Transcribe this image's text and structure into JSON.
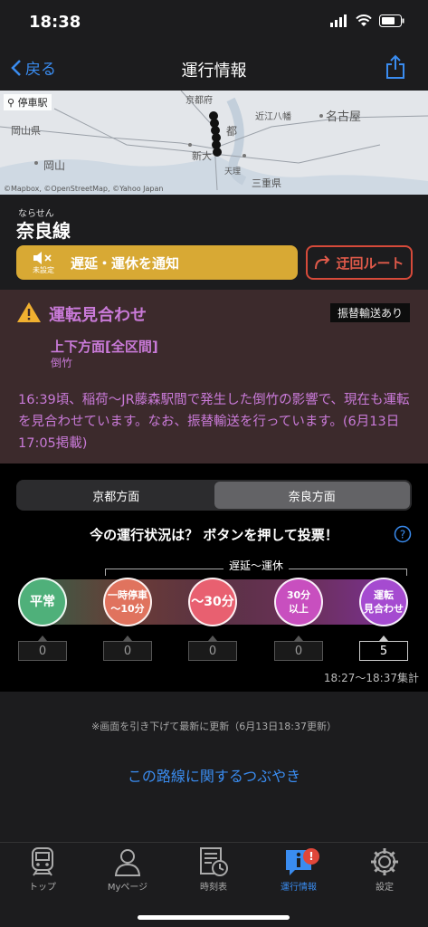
{
  "status_bar": {
    "time": "18:38"
  },
  "nav": {
    "back_label": "戻る",
    "title": "運行情報"
  },
  "map": {
    "station_label": "停車駅",
    "credit": "©Mapbox, ©OpenStreetMap, ©Yahoo Japan",
    "places": [
      "京都府",
      "都",
      "近江八幡",
      "名古屋",
      "岡山県",
      "新大",
      "天理",
      "三重県",
      "岡山"
    ]
  },
  "line": {
    "ruby": "ならせん",
    "name": "奈良線",
    "notify_sub": "未設定",
    "notify_label": "遅延・運休を通知",
    "detour_label": "迂回ルート"
  },
  "alert": {
    "title": "運転見合わせ",
    "badge": "振替輸送あり",
    "section": "上下方面[全区間]",
    "cause": "倒竹",
    "body": "16:39頃、稲荷〜JR藤森駅間で発生した倒竹の影響で、現在も運転を見合わせています。なお、振替輸送を行っています。(6月13日17:05掲載)"
  },
  "vote": {
    "tabs": [
      "京都方面",
      "奈良方面"
    ],
    "active_tab": 1,
    "question": "今の運行状況は？ ボタンを押して投票！",
    "range_label": "遅延〜運休",
    "options": [
      {
        "label": "平常",
        "count": "0",
        "color": "#4fb07a"
      },
      {
        "label": "一時停車\n〜10分",
        "count": "0",
        "color": "#e0735e"
      },
      {
        "label": "〜30分",
        "count": "0",
        "color": "#e86070"
      },
      {
        "label": "30分\n以上",
        "count": "0",
        "color": "#c84fbf"
      },
      {
        "label": "運転\n見合わせ",
        "count": "5",
        "color": "#a54bd0"
      }
    ],
    "period": "18:27〜18:37集計"
  },
  "footer": {
    "refresh_note": "※画面を引き下げて最新に更新（6月13日18:37更新）",
    "tweets_link": "この路線に関するつぶやき"
  },
  "tabbar": {
    "items": [
      {
        "label": "トップ",
        "icon": "train-icon"
      },
      {
        "label": "Myページ",
        "icon": "person-icon"
      },
      {
        "label": "時刻表",
        "icon": "timetable-icon"
      },
      {
        "label": "運行情報",
        "icon": "info-icon"
      },
      {
        "label": "設定",
        "icon": "gear-icon"
      }
    ],
    "active": 3,
    "badge": "!"
  },
  "colors": {
    "accent_blue": "#3a8cf0",
    "alert_purple": "#c97ad8",
    "notify_gold": "#d8a934",
    "detour_red": "#d64a3a"
  }
}
